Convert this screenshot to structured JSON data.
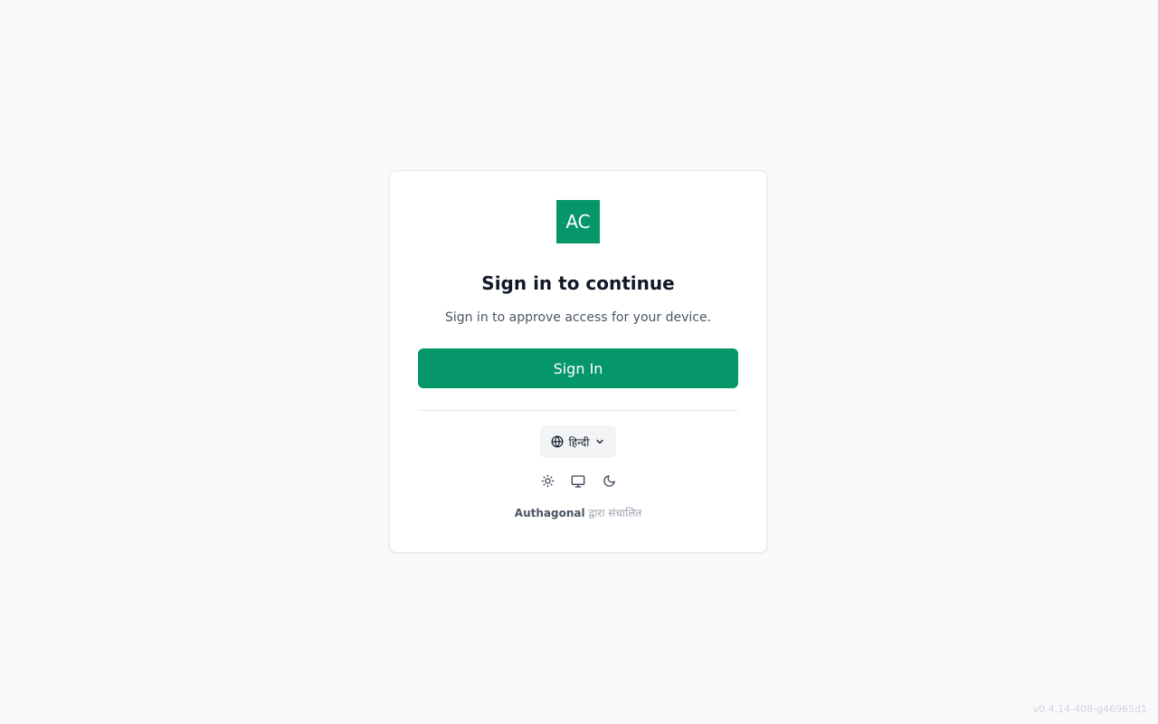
{
  "app": {
    "logo_text": "AC",
    "brand_color": "#059669"
  },
  "login": {
    "title": "Sign in to continue",
    "subtitle": "Sign in to approve access for your device.",
    "signin_label": "Sign In"
  },
  "language": {
    "selected": "हिन्दी",
    "icon": "globe-icon"
  },
  "theme": {
    "options": [
      "light",
      "system",
      "dark"
    ],
    "icons": [
      "sun-icon",
      "monitor-icon",
      "moon-icon"
    ]
  },
  "footer": {
    "brand": "Authagonal",
    "powered_suffix": "द्वारा संचालित",
    "version": "v0.4.14-408-g46965d1"
  }
}
